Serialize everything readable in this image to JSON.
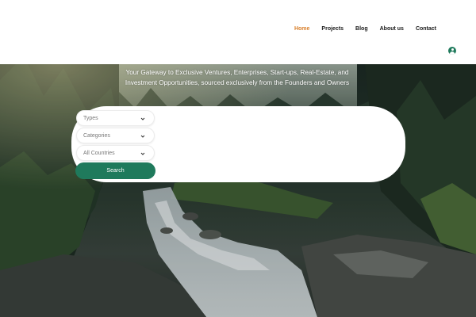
{
  "nav": {
    "items": [
      {
        "label": "Home",
        "active": true
      },
      {
        "label": "Projects",
        "active": false
      },
      {
        "label": "Blog",
        "active": false
      },
      {
        "label": "About us",
        "active": false
      },
      {
        "label": "Contact",
        "active": false
      }
    ]
  },
  "hero": {
    "tagline_line1": "Your Gateway to Exclusive Ventures, Enterprises, Start-ups, Real-Estate, and",
    "tagline_line2": "Investment Opportunities, sourced exclusively from the Founders and Owners"
  },
  "search": {
    "filters": [
      {
        "selected": "Types"
      },
      {
        "selected": "Categories"
      },
      {
        "selected": "All Countries"
      }
    ],
    "button_label": "Search"
  },
  "colors": {
    "accent": "#1f7a5c",
    "active_nav": "#d97f2a"
  },
  "icons": {
    "user": "user-icon",
    "dropdown": "chevron-down-icon"
  }
}
